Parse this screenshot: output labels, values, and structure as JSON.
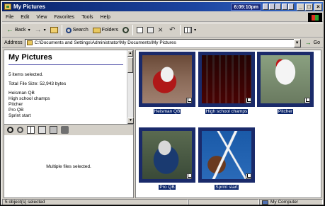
{
  "window": {
    "title": "My Pictures",
    "clock": "6:09:10pm"
  },
  "menu": [
    "File",
    "Edit",
    "View",
    "Favorites",
    "Tools",
    "Help"
  ],
  "toolbar": {
    "back": "Back",
    "search": "Search",
    "folders": "Folders"
  },
  "address": {
    "label": "Address",
    "value": "C:\\Documents and Settings\\Administrator\\My Documents\\My Pictures",
    "go": "Go"
  },
  "left_pane": {
    "title": "My Pictures",
    "selected_count": "5 items selected.",
    "total_size": "Total File Size: 52,943 bytes",
    "files": [
      "Heisman QB",
      "High school champs",
      "Pitcher",
      "Pro QB",
      "Sprint start"
    ],
    "preview_message": "Multiple files selected."
  },
  "thumbnails": [
    {
      "label": "Heisman QB",
      "icon": "photo-heisman"
    },
    {
      "label": "High school champs",
      "icon": "photo-champs"
    },
    {
      "label": "Pitcher",
      "icon": "photo-pitcher"
    },
    {
      "label": "Pro QB",
      "icon": "photo-proqb"
    },
    {
      "label": "Sprint start",
      "icon": "photo-sprint"
    }
  ],
  "status": {
    "left": "5 object(s) selected",
    "right": "My Computer"
  },
  "colors": {
    "titlebar": "#0a246a",
    "selection": "#0a246a",
    "chrome": "#d4d0c8"
  }
}
